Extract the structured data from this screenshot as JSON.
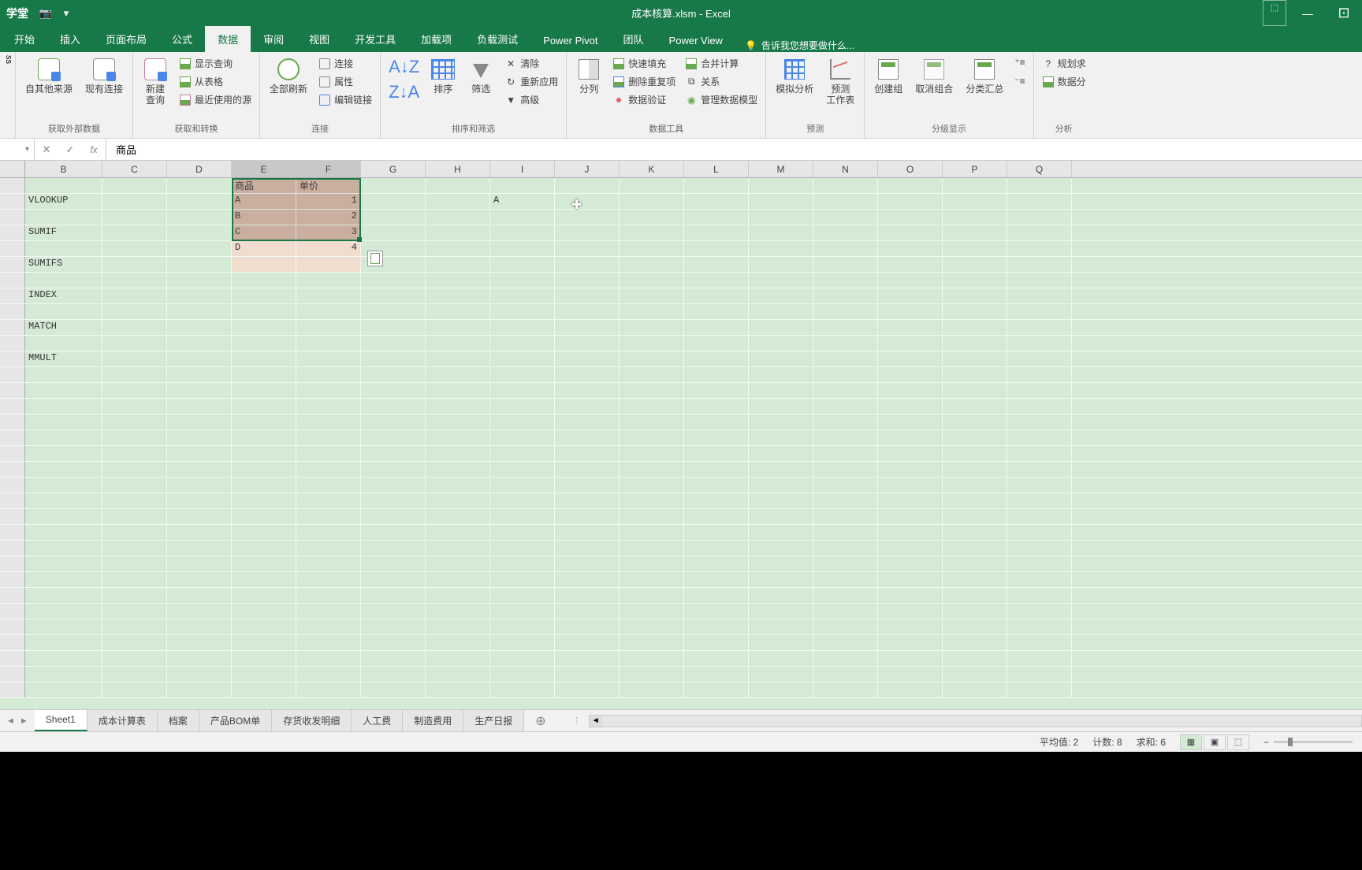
{
  "title": "成本核算.xlsm - Excel",
  "ribbon_tabs": [
    "开始",
    "插入",
    "页面布局",
    "公式",
    "数据",
    "审阅",
    "视图",
    "开发工具",
    "加载项",
    "负载测试",
    "Power Pivot",
    "团队",
    "Power View"
  ],
  "active_tab_index": 4,
  "tell_me": "告诉我您想要做什么...",
  "groups": {
    "get_external": {
      "label": "获取外部数据",
      "other_sources": "自其他来源",
      "existing": "现有连接"
    },
    "get_transform": {
      "label": "获取和转换",
      "new_query": "新建\n查询",
      "show_query": "显示查询",
      "from_table": "从表格",
      "recent": "最近使用的源"
    },
    "connections": {
      "label": "连接",
      "refresh_all": "全部刷新",
      "conn": "连接",
      "props": "属性",
      "edit_links": "编辑链接"
    },
    "sort_filter": {
      "label": "排序和筛选",
      "sort_az": "A↓Z",
      "sort_za": "Z↓A",
      "sort": "排序",
      "filter": "筛选",
      "clear": "清除",
      "reapply": "重新应用",
      "advanced": "高级"
    },
    "data_tools": {
      "label": "数据工具",
      "text_to_col": "分列",
      "flash_fill": "快速填充",
      "remove_dup": "删除重复项",
      "validation": "数据验证",
      "consolidate": "合并计算",
      "relationships": "关系",
      "manage_model": "管理数据模型"
    },
    "forecast": {
      "label": "预测",
      "whatif": "模拟分析",
      "forecast_sheet": "预测\n工作表"
    },
    "outline": {
      "label": "分级显示",
      "group": "创建组",
      "ungroup": "取消组合",
      "subtotal": "分类汇总"
    },
    "analysis": {
      "label": "分析",
      "solver": "规划求",
      "data_an": "数据分"
    }
  },
  "formula_bar": {
    "value": "商品"
  },
  "columns": [
    "B",
    "C",
    "D",
    "E",
    "F",
    "G",
    "H",
    "I",
    "J",
    "K",
    "L",
    "M",
    "N",
    "O",
    "P",
    "Q"
  ],
  "col_b_values": [
    "",
    "VLOOKUP",
    "",
    "SUMIF",
    "",
    "SUMIFS",
    "",
    "INDEX",
    "",
    "MATCH",
    "",
    "MMULT"
  ],
  "table": {
    "headers": [
      "商品",
      "单价"
    ],
    "rows": [
      [
        "A",
        "1"
      ],
      [
        "B",
        "2"
      ],
      [
        "C",
        "3"
      ],
      [
        "D",
        "4"
      ]
    ]
  },
  "cell_I2": "A",
  "sheet_tabs": [
    "Sheet1",
    "成本计算表",
    "档案",
    "产品BOM单",
    "存货收发明细",
    "人工费",
    "制造费用",
    "生产日报"
  ],
  "active_sheet_index": 0,
  "status": {
    "avg_label": "平均值:",
    "avg": "2",
    "count_label": "计数:",
    "count": "8",
    "sum_label": "求和:",
    "sum": "6"
  }
}
